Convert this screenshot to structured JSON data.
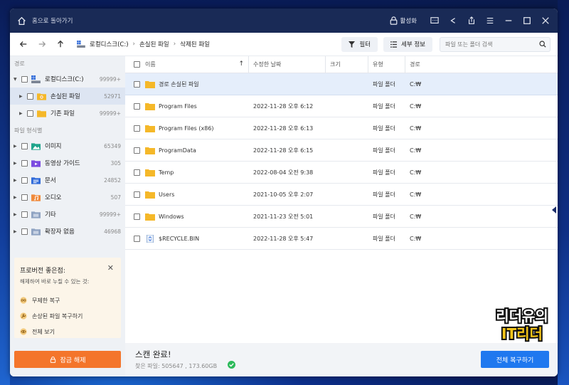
{
  "titlebar": {
    "home_label": "홈으로 돌아가기",
    "activate_label": "활성화"
  },
  "breadcrumb": [
    "로컬디스크(C:)",
    "손실된 파일",
    "삭제된 파일"
  ],
  "toolbar": {
    "filter_label": "필터",
    "details_label": "세부 정보",
    "search_placeholder": "파일 또는 폴더 검색"
  },
  "sidebar": {
    "path_header": "경로",
    "type_header": "파일 형식별",
    "path_items": [
      {
        "label": "로컬디스크(C:)",
        "count": "99999+"
      },
      {
        "label": "손실된 파일",
        "count": "52971"
      },
      {
        "label": "기존 파일",
        "count": "99999+"
      }
    ],
    "type_items": [
      {
        "label": "이미지",
        "count": "65349",
        "icon": "image-icon"
      },
      {
        "label": "동영상 가이드",
        "count": "305",
        "icon": "video-icon"
      },
      {
        "label": "문서",
        "count": "24852",
        "icon": "document-icon"
      },
      {
        "label": "오디오",
        "count": "507",
        "icon": "audio-icon"
      },
      {
        "label": "기타",
        "count": "99999+",
        "icon": "other-icon"
      },
      {
        "label": "확장자 없음",
        "count": "46968",
        "icon": "no-extension-icon"
      }
    ]
  },
  "promo": {
    "title": "프로버전 좋은점:",
    "subtitle": "해제하여 바로 누릴 수 있는 것:",
    "items": [
      "무제한 복구",
      "손상된 파일 복구하기",
      "전체 보기"
    ]
  },
  "unlock_label": "잠금 해제",
  "table": {
    "headers": {
      "name": "이름",
      "date": "수정한 날짜",
      "size": "크기",
      "type": "유형",
      "path": "경로"
    },
    "rows": [
      {
        "name": "경로 손실된 파일",
        "date": "",
        "size": "",
        "type": "파일 폴더",
        "path": "C:₩"
      },
      {
        "name": "Program Files",
        "date": "2022-11-28 오후 6:12",
        "size": "",
        "type": "파일 폴더",
        "path": "C:₩"
      },
      {
        "name": "Program Files (x86)",
        "date": "2022-11-28 오후 6:13",
        "size": "",
        "type": "파일 폴더",
        "path": "C:₩"
      },
      {
        "name": "ProgramData",
        "date": "2022-11-28 오후 6:15",
        "size": "",
        "type": "파일 폴더",
        "path": "C:₩"
      },
      {
        "name": "Temp",
        "date": "2022-08-04 오전 9:38",
        "size": "",
        "type": "파일 폴더",
        "path": "C:₩"
      },
      {
        "name": "Users",
        "date": "2021-10-05 오후 2:07",
        "size": "",
        "type": "파일 폴더",
        "path": "C:₩"
      },
      {
        "name": "Windows",
        "date": "2021-11-23 오전 5:01",
        "size": "",
        "type": "파일 폴더",
        "path": "C:₩"
      },
      {
        "name": "$RECYCLE.BIN",
        "date": "2022-11-28 오후 5:47",
        "size": "",
        "type": "파일 폴더",
        "path": "C:₩"
      }
    ]
  },
  "status": {
    "title": "스캔 완료!",
    "found": "찾은 파일: 505647 , 173.60GB",
    "recover_all_label": "전체 복구하기"
  },
  "watermark": {
    "line1": "리더유의",
    "line2": "IT리더"
  },
  "colors": {
    "titlebar": "#192a56",
    "accent": "#1f78ef",
    "unlock": "#f4752b",
    "folder": "#f5b829"
  }
}
